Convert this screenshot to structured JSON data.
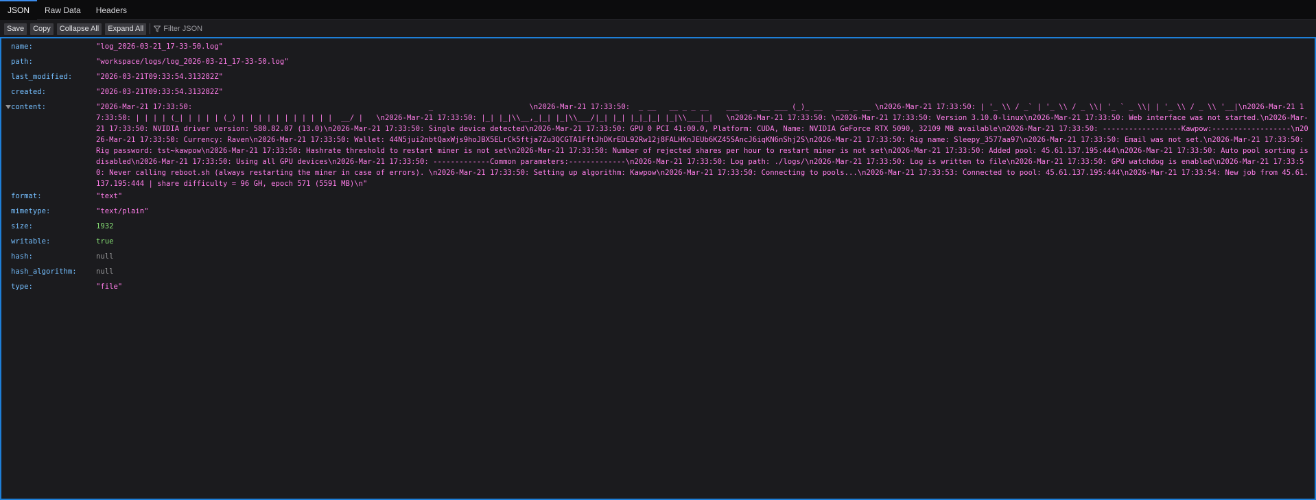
{
  "tabs": [
    {
      "label": "JSON",
      "active": true
    },
    {
      "label": "Raw Data",
      "active": false
    },
    {
      "label": "Headers",
      "active": false
    }
  ],
  "toolbar": {
    "save": "Save",
    "copy": "Copy",
    "collapse_all": "Collapse All",
    "expand_all": "Expand All",
    "filter_placeholder": "Filter JSON",
    "filter_icon": "funnel-icon"
  },
  "fields": [
    {
      "key": "name:",
      "value": "\"log_2026-03-21_17-33-50.log\"",
      "type": "string"
    },
    {
      "key": "path:",
      "value": "\"workspace/logs/log_2026-03-21_17-33-50.log\"",
      "type": "string"
    },
    {
      "key": "last_modified:",
      "value": "\"2026-03-21T09:33:54.313282Z\"",
      "type": "string"
    },
    {
      "key": "created:",
      "value": "\"2026-03-21T09:33:54.313282Z\"",
      "type": "string"
    },
    {
      "key": "content:",
      "value": "\"2026-Mar-21 17:33:50:                                                      _                      \\n2026-Mar-21 17:33:50:  _ __   __ _ _ __    ___   _ __ ___ (_)_ __   ___ _ __ \\n2026-Mar-21 17:33:50: | '_ \\\\ / _` | '_ \\\\ / _ \\\\| '_ ` _ \\\\| | '_ \\\\ / _ \\\\ '__|\\n2026-Mar-21 17:33:50: | | | | (_| | | | | (_) | | | | | | | | | | |  __/ |   \\n2026-Mar-21 17:33:50: |_| |_|\\\\__,_|_| |_|\\\\___/|_| |_| |_|_|_| |_|\\\\___|_|   \\n2026-Mar-21 17:33:50: \\n2026-Mar-21 17:33:50: Version 3.10.0-linux\\n2026-Mar-21 17:33:50: Web interface was not started.\\n2026-Mar-21 17:33:50: NVIDIA driver version: 580.82.07 (13.0)\\n2026-Mar-21 17:33:50: Single device detected\\n2026-Mar-21 17:33:50: GPU 0 PCI 41:00.0, Platform: CUDA, Name: NVIDIA GeForce RTX 5090, 32109 MB available\\n2026-Mar-21 17:33:50: ------------------Kawpow:------------------\\n2026-Mar-21 17:33:50: Currency: Raven\\n2026-Mar-21 17:33:50: Wallet: 44N5jui2nbtQaxWjs9hoJBX5ELrCk5ftja7Zu3QCGTA1FftJhDKrEDL92Rw12j8FALHKnJEUb6KZ45SAncJ6iqKN6nShj2S\\n2026-Mar-21 17:33:50: Rig name: Sleepy_3577aa97\\n2026-Mar-21 17:33:50: Email was not set.\\n2026-Mar-21 17:33:50: Rig password: tst~kawpow\\n2026-Mar-21 17:33:50: Hashrate threshold to restart miner is not set\\n2026-Mar-21 17:33:50: Number of rejected shares per hour to restart miner is not set\\n2026-Mar-21 17:33:50: Added pool: 45.61.137.195:444\\n2026-Mar-21 17:33:50: Auto pool sorting is disabled\\n2026-Mar-21 17:33:50: Using all GPU devices\\n2026-Mar-21 17:33:50: -------------Common parameters:-------------\\n2026-Mar-21 17:33:50: Log path: ./logs/\\n2026-Mar-21 17:33:50: Log is written to file\\n2026-Mar-21 17:33:50: GPU watchdog is enabled\\n2026-Mar-21 17:33:50: Never calling reboot.sh (always restarting the miner in case of errors). \\n2026-Mar-21 17:33:50: Setting up algorithm: Kawpow\\n2026-Mar-21 17:33:50: Connecting to pools...\\n2026-Mar-21 17:33:53: Connected to pool: 45.61.137.195:444\\n2026-Mar-21 17:33:54: New job from 45.61.137.195:444 | share difficulty = 96 GH, epoch 571 (5591 MB)\\n\"",
      "type": "string",
      "expandable": true
    },
    {
      "key": "format:",
      "value": "\"text\"",
      "type": "string"
    },
    {
      "key": "mimetype:",
      "value": "\"text/plain\"",
      "type": "string"
    },
    {
      "key": "size:",
      "value": "1932",
      "type": "number"
    },
    {
      "key": "writable:",
      "value": "true",
      "type": "bool"
    },
    {
      "key": "hash:",
      "value": "null",
      "type": "null"
    },
    {
      "key": "hash_algorithm:",
      "value": "null",
      "type": "null"
    },
    {
      "key": "type:",
      "value": "\"file\"",
      "type": "string"
    }
  ],
  "colors": {
    "accent": "#1e7fd8",
    "key": "#75bfff",
    "string": "#ff7de9",
    "number": "#86de74",
    "null": "#939395"
  }
}
